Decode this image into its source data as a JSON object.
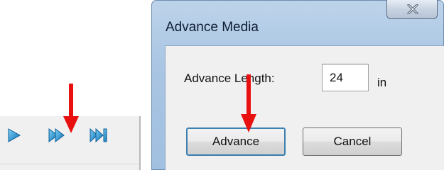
{
  "toolbar": {
    "buttons": [
      {
        "name": "play",
        "icon": "play-icon"
      },
      {
        "name": "advance-media",
        "icon": "double-play-icon"
      },
      {
        "name": "advance-to-end",
        "icon": "skip-to-end-icon"
      }
    ],
    "icon_color": "#1e9ad6"
  },
  "dialog": {
    "title": "Advance Media",
    "close_icon": "close-icon",
    "length_label": "Advance Length:",
    "length_value": "24",
    "unit": "in",
    "advance_label": "Advance",
    "cancel_label": "Cancel"
  },
  "annotation_color": "#e8110f"
}
